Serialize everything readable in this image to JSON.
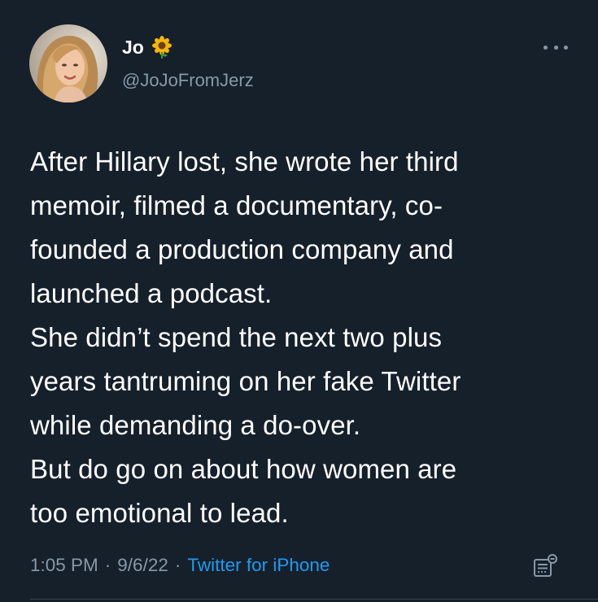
{
  "author": {
    "display_name": "Jo",
    "name_emoji_icon": "sunflower-icon",
    "handle": "@JoJoFromJerz"
  },
  "menu_icon": "more-horizontal-icon",
  "tweet_text": [
    "After Hillary lost, she wrote her third",
    "memoir, filmed a documentary, co-",
    "founded a production company and",
    "launched a podcast.",
    "She didn’t spend the next two plus",
    "years tantruming on her fake Twitter",
    "while demanding a do-over.",
    "But do go on about how women are",
    "too emotional to lead."
  ],
  "meta": {
    "time": "1:05 PM",
    "separator": "·",
    "date": "9/6/22",
    "source": "Twitter for iPhone"
  },
  "analytics_icon": "analytics-icon",
  "colors": {
    "background": "#15202b",
    "text": "#ffffff",
    "secondary": "#8899a6",
    "link": "#1d9bf0"
  }
}
